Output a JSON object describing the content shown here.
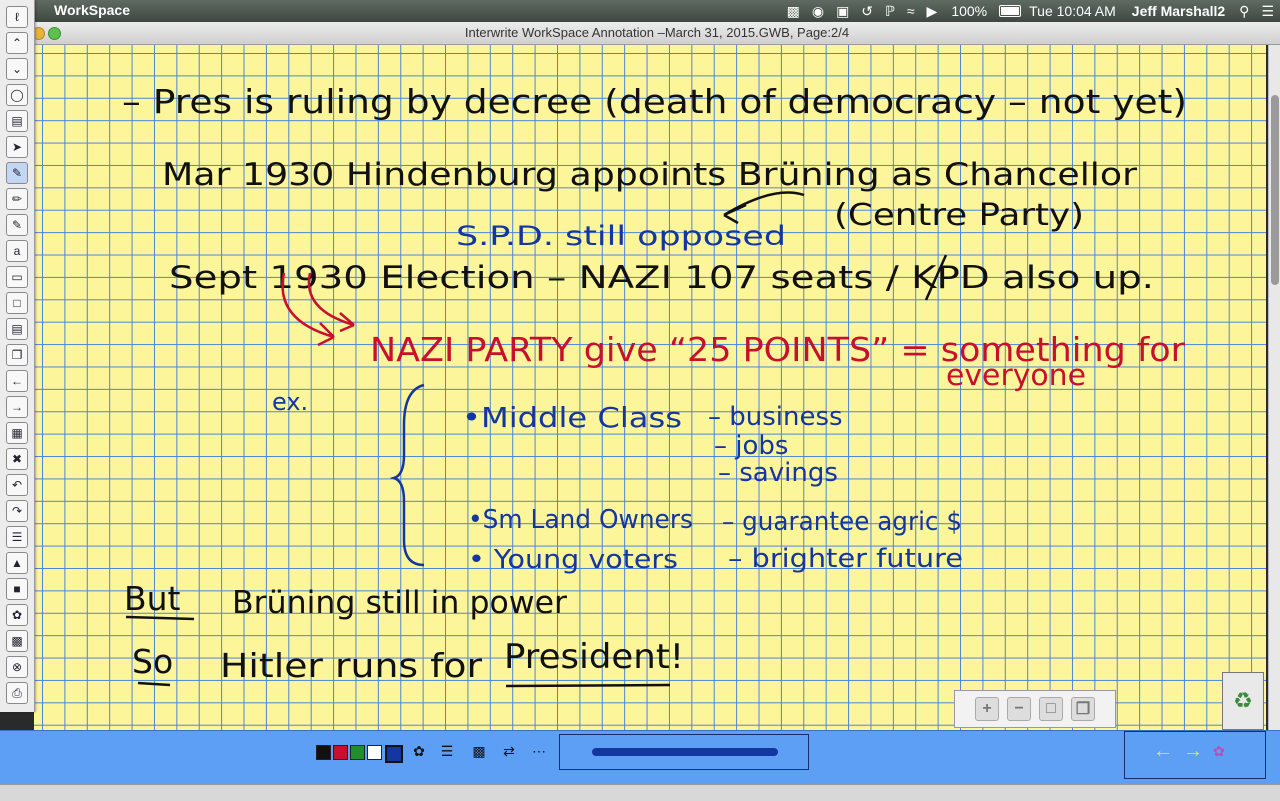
{
  "menubar": {
    "app_name": "WorkSpace",
    "battery_pct": "100%",
    "clock": "Tue 10:04 AM",
    "user": "Jeff Marshall2",
    "icons": [
      "app-logo-icon",
      "workspace-menu-icon",
      "camera-icon",
      "airplay-icon",
      "time-machine-icon",
      "bluetooth-icon",
      "wifi-icon",
      "volume-icon",
      "battery-icon",
      "search-icon",
      "list-icon"
    ]
  },
  "window": {
    "title": "Interwrite WorkSpace Annotation –March 31, 2015.GWB, Page:2/4"
  },
  "toolbar": {
    "tools": [
      "pin-icon",
      "up-icon",
      "down-icon",
      "mouse-icon",
      "save-icon",
      "select-arrow-icon",
      "pen-icon",
      "highlighter-icon",
      "marker-icon",
      "text-recognition-icon",
      "eraser-icon",
      "blank-page-icon",
      "lined-page-icon",
      "copy-page-icon",
      "previous-page-icon",
      "next-page-icon",
      "page-sorter-icon",
      "delete-icon",
      "undo-icon",
      "redo-icon",
      "lines-icon",
      "shapes-icon",
      "fill-icon",
      "paint-icon",
      "hand-icon",
      "screen-capture-icon",
      "close-icon",
      "print-icon"
    ]
  },
  "notes": {
    "line1": "– Pres is ruling by decree (death of democracy – not yet)",
    "line2": "Mar 1930   Hindenburg appoints Brüning as Chancellor",
    "line2b": "(Centre Party)",
    "line3": "S.P.D. still opposed",
    "line4": "Sept 1930  Election  –  NAZI 107 seats / KPD also up.",
    "line5": "NAZI PARTY give “25 POINTS” = something for",
    "line5b": "everyone",
    "ex": "ex.",
    "bullet1": "•Middle Class",
    "bullet1_items": [
      "– business",
      "– jobs",
      "– savings"
    ],
    "bullet2": "•Sm Land Owners",
    "bullet2_item": "– guarantee agric $",
    "bullet3": "• Young voters",
    "bullet3_item": "– brighter future",
    "but": "But",
    "but_rest": "Brüning still in power",
    "so": "So",
    "so_rest": "Hitler runs for",
    "president": "President!"
  },
  "zoom_controls": {
    "icons": [
      "zoom-in-icon",
      "zoom-out-icon",
      "page-icon",
      "duplicate-icon"
    ]
  },
  "bottombar": {
    "swatches": [
      "#111111",
      "#c8102e",
      "#1f8f2e",
      "#ffffff",
      "#1436a0"
    ],
    "tools": [
      "palette-icon",
      "line-width-icon",
      "transparency-icon",
      "line-style-icon",
      "dash-style-icon"
    ],
    "nav": [
      "back-arrow-icon",
      "forward-arrow-icon",
      "flower-icon"
    ]
  },
  "colors": {
    "ink_black": "#111111",
    "ink_blue": "#1436a0",
    "ink_red": "#c8102e",
    "paper": "#fcf59a",
    "grid": "#4b86d6"
  }
}
